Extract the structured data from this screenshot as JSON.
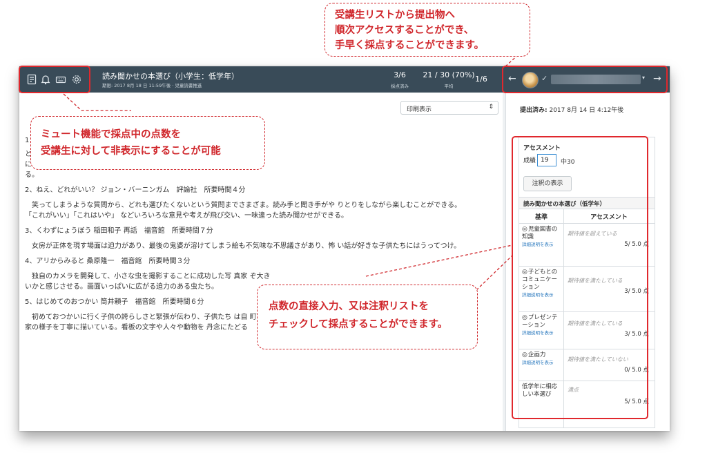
{
  "header": {
    "assignment_title": "読み聞かせの本選び（小学生：低学年）",
    "assignment_sub": "期限: 2017 8月 18 日 11:59午後 · 児童読書推進",
    "graded_count": "3/6",
    "graded_label": "採点済み",
    "average_value": "21 / 30 (70%)",
    "average_label": "平均",
    "student_position": "1/6",
    "prev_arrow": "←",
    "next_arrow": "→",
    "student_dropdown_caret": "▾",
    "check_mark": "✓",
    "icons": [
      "speedgrader-icon",
      "bell-icon",
      "keyboard-icon",
      "gear-icon"
    ]
  },
  "document": {
    "print_view_select": "印刷表示",
    "lines": [
      "1",
      "と                                                                                         いさ」と元気に世の中を 渡っていく。そんな子ネコを誰もが応援せず",
      "に                                                                                          た体裁。まっすぐ単純なストーリーなので、幼い子供から十分楽しめ",
      "る。",
      "2、ねえ、どれがいい？ ジョン・バーニンガム　評論社　所要時間４分",
      "　笑ってしまうような質問から、どれも選びたくないという質問までさまざま。読み手と聞き手がや りとりをしながら楽しむことができる。",
      "「これがいい」「これはいや」 などいろいろな意見や考えが飛び交い、一味違った読み聞かせができる。",
      "3、くわずにょうぼう 稲田和子 再話　福音館　所要時間７分",
      "　女房が正体を現す場面は迫力があり、最後の鬼婆が溶けてしまう絵も不気味な不思議さがあり、怖 い話が好きな子供たちにはうってつけ。",
      "4、アリからみると 桑原隆一　福音館　所要時間３分",
      "　独自のカメラを開発して、小さな虫を撮影することに成功した写 真家                                                                   ぞ大き",
      "いかと感じさせる。画面いっぱいに広がる迫力のある虫たち。",
      "5、はじめてのおつかい 筒井頼子　福音館　所要時間６分",
      "　初めておつかいに行く子供の誇らしさと緊張が伝わり、子供たち は自                                                                   町や",
      "家の様子を丁寧に描いている。看板の文字や人々や動物を 丹念にたどる"
    ]
  },
  "sidebar": {
    "submitted_label": "提出済み:",
    "submitted_date": "2017 8月 14 日 4:12午後",
    "assessment_heading": "アセスメント",
    "grade_label": "成績",
    "grade_value": "19",
    "grade_out_of": "中30",
    "show_annotations_button": "注釈の表示",
    "rubric_title": "読み聞かせの本選び（低学年）",
    "col_criteria": "基準",
    "col_assessment": "アセスメント",
    "criteria": [
      {
        "name": "児童図書の知識",
        "link": "詳細説明を表示",
        "rating": "期待値を超えている",
        "points": "5/ 5.0 点"
      },
      {
        "name": "子どもとのコミュニケーション",
        "link": "詳細説明を表示",
        "rating": "期待値を満たしている",
        "points": "3/ 5.0 点"
      },
      {
        "name": "プレゼンテーション",
        "link": "詳細説明を表示",
        "rating": "期待値を満たしている",
        "points": "3/ 5.0 点"
      },
      {
        "name": "企画力",
        "link": "詳細説明を表示",
        "rating": "期待値を満たしていない",
        "points": "0/ 5.0 点"
      },
      {
        "name": "低学年に相応しい本選び",
        "link": "",
        "rating": "満点",
        "points": "5/ 5.0 点"
      }
    ]
  },
  "callouts": {
    "top_right_line1": "受講生リストから提出物へ",
    "top_right_line2": "順次アクセスすることができ、",
    "top_right_line3": "手早く採点することができます。",
    "left_line1": "ミュート機能で採点中の点数を",
    "left_line2": "受講生に対して非表示にすることが可能",
    "center_line1": "点数の直接入力、又は注釈リストを",
    "center_line2": "チェックして採点することができます。"
  },
  "colors": {
    "topbar": "#394b58",
    "callout_red": "#d0262b",
    "link_blue": "#2d7bbf"
  }
}
